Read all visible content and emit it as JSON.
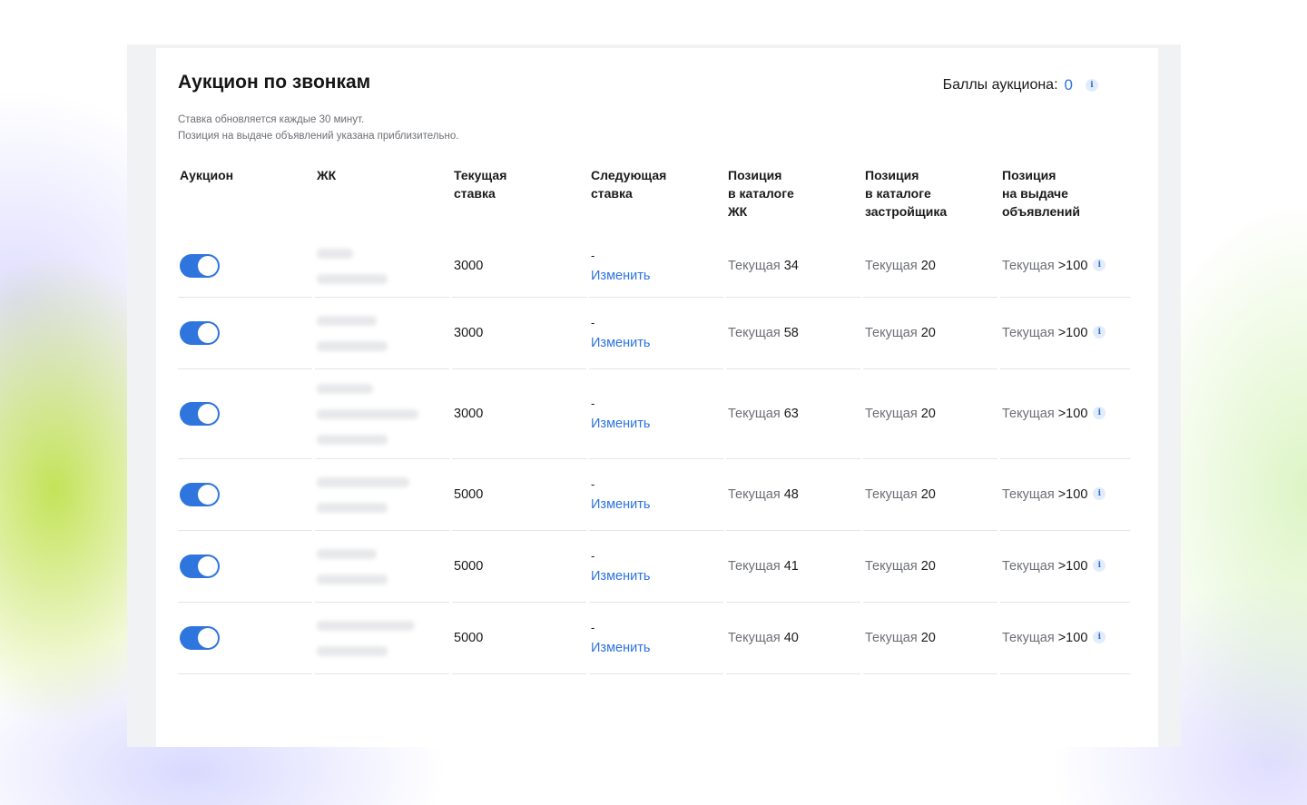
{
  "header": {
    "title": "Аукцион по звонкам",
    "points_label": "Баллы аукциона:",
    "points_value": "0",
    "info_glyph": "i"
  },
  "notice": {
    "line1": "Ставка обновляется каждые 30 минут.",
    "line2": "Позиция на выдаче объявлений указана приблизительно."
  },
  "table": {
    "columns": [
      "Аукцион",
      "ЖК",
      "Текущая\nставка",
      "Следующая\nставка",
      "Позиция\nв каталоге\nЖК",
      "Позиция\nв каталоге\nзастройщика",
      "Позиция\nна выдаче\nобъявлений"
    ],
    "rows": [
      {
        "auction_on": true,
        "current_bid": "3000",
        "next_bid": "-",
        "change_label": "Изменить",
        "pos_label": "Текущая",
        "pos_catalog_complex": "34",
        "pos_catalog_developer": "20",
        "pos_listing": ">100"
      },
      {
        "auction_on": true,
        "current_bid": "3000",
        "next_bid": "-",
        "change_label": "Изменить",
        "pos_label": "Текущая",
        "pos_catalog_complex": "58",
        "pos_catalog_developer": "20",
        "pos_listing": ">100"
      },
      {
        "auction_on": true,
        "current_bid": "3000",
        "next_bid": "-",
        "change_label": "Изменить",
        "pos_label": "Текущая",
        "pos_catalog_complex": "63",
        "pos_catalog_developer": "20",
        "pos_listing": ">100"
      },
      {
        "auction_on": true,
        "current_bid": "5000",
        "next_bid": "-",
        "change_label": "Изменить",
        "pos_label": "Текущая",
        "pos_catalog_complex": "48",
        "pos_catalog_developer": "20",
        "pos_listing": ">100"
      },
      {
        "auction_on": true,
        "current_bid": "5000",
        "next_bid": "-",
        "change_label": "Изменить",
        "pos_label": "Текущая",
        "pos_catalog_complex": "41",
        "pos_catalog_developer": "20",
        "pos_listing": ">100"
      },
      {
        "auction_on": true,
        "current_bid": "5000",
        "next_bid": "-",
        "change_label": "Изменить",
        "pos_label": "Текущая",
        "pos_catalog_complex": "40",
        "pos_catalog_developer": "20",
        "pos_listing": ">100"
      }
    ]
  },
  "colors": {
    "accent": "#2b73e1",
    "toggle_on": "#2e75dd"
  },
  "icons": {
    "toggle": "toggle-switch-icon",
    "info": "info-icon"
  }
}
